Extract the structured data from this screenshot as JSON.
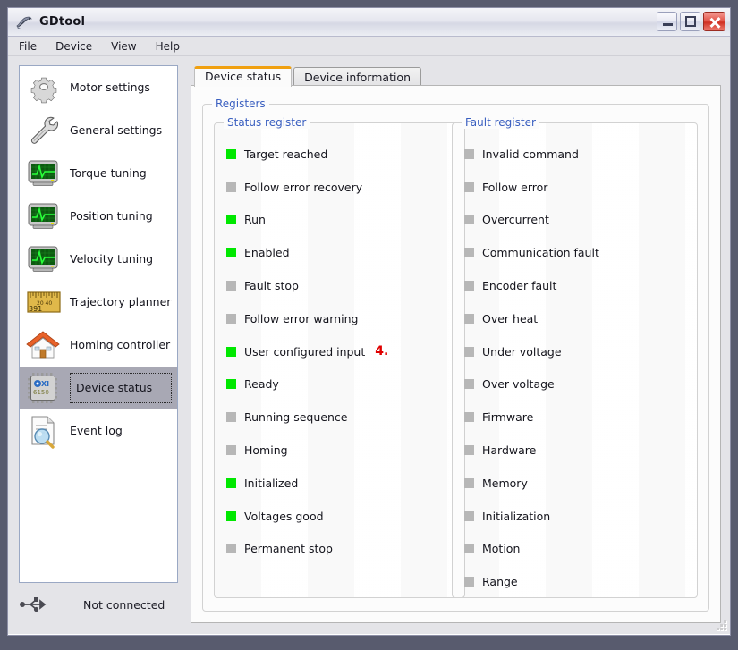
{
  "window": {
    "title": "GDtool",
    "icon": "app-icon",
    "buttons": {
      "minimize": "minimize-button",
      "maximize": "maximize-button",
      "close": "close-button"
    }
  },
  "menubar": {
    "items": [
      {
        "label": "File"
      },
      {
        "label": "Device"
      },
      {
        "label": "View"
      },
      {
        "label": "Help"
      }
    ]
  },
  "sidebar": {
    "items": [
      {
        "label": "Motor settings",
        "icon": "gear-icon",
        "selected": false
      },
      {
        "label": "General settings",
        "icon": "wrench-icon",
        "selected": false
      },
      {
        "label": "Torque tuning",
        "icon": "monitor-icon",
        "selected": false
      },
      {
        "label": "Position tuning",
        "icon": "monitor-icon",
        "selected": false
      },
      {
        "label": "Velocity tuning",
        "icon": "monitor-icon",
        "selected": false
      },
      {
        "label": "Trajectory planner",
        "icon": "ruler-icon",
        "selected": false
      },
      {
        "label": "Homing controller",
        "icon": "house-icon",
        "selected": false
      },
      {
        "label": "Device status",
        "icon": "chip-icon",
        "selected": true
      },
      {
        "label": "Event log",
        "icon": "document-search-icon",
        "selected": false
      }
    ]
  },
  "ruler_icon_text": {
    "ticks": "20  40",
    "value": "391"
  },
  "chip_icon_text": {
    "brand": "XI",
    "code": "6150"
  },
  "connection": {
    "icon": "usb-icon",
    "status": "Not connected"
  },
  "tabs": [
    {
      "label": "Device status",
      "active": true
    },
    {
      "label": "Device information",
      "active": false
    }
  ],
  "registers_group": {
    "title": "Registers"
  },
  "status_register": {
    "title": "Status register",
    "items": [
      {
        "label": "Target reached",
        "on": true
      },
      {
        "label": "Follow error recovery",
        "on": false
      },
      {
        "label": "Run",
        "on": true
      },
      {
        "label": "Enabled",
        "on": true
      },
      {
        "label": "Fault stop",
        "on": false
      },
      {
        "label": "Follow error warning",
        "on": false
      },
      {
        "label": "User configured input",
        "on": true,
        "annotation": "4."
      },
      {
        "label": "Ready",
        "on": true
      },
      {
        "label": "Running sequence",
        "on": false
      },
      {
        "label": "Homing",
        "on": false
      },
      {
        "label": "Initialized",
        "on": true
      },
      {
        "label": "Voltages good",
        "on": true
      },
      {
        "label": "Permanent stop",
        "on": false
      }
    ]
  },
  "fault_register": {
    "title": "Fault register",
    "items": [
      {
        "label": "Invalid command",
        "on": false
      },
      {
        "label": "Follow error",
        "on": false
      },
      {
        "label": "Overcurrent",
        "on": false
      },
      {
        "label": "Communication fault",
        "on": false
      },
      {
        "label": "Encoder fault",
        "on": false
      },
      {
        "label": "Over heat",
        "on": false
      },
      {
        "label": "Under voltage",
        "on": false
      },
      {
        "label": "Over voltage",
        "on": false
      },
      {
        "label": "Firmware",
        "on": false
      },
      {
        "label": "Hardware",
        "on": false
      },
      {
        "label": "Memory",
        "on": false
      },
      {
        "label": "Initialization",
        "on": false
      },
      {
        "label": "Motion",
        "on": false
      },
      {
        "label": "Range",
        "on": false
      }
    ]
  },
  "colors": {
    "led_on": "#00e800",
    "led_off": "#b7b7b7",
    "group_title": "#3a5fc0",
    "active_tab_accent": "#f0a010",
    "annotation": "#e00000",
    "desktop": "#585b6e",
    "window_bg": "#e4e4e8",
    "selection": "#a8a8b4"
  }
}
